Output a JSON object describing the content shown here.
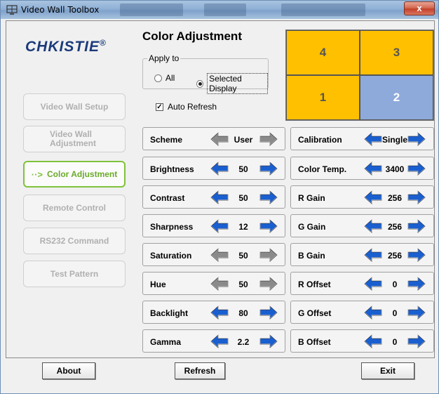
{
  "window": {
    "title": "Video Wall Toolbox",
    "close_label": "x"
  },
  "logo": {
    "text": "CHKISTIE",
    "reg": "®"
  },
  "sidebar": {
    "items": [
      {
        "label": "Video Wall Setup",
        "active": false
      },
      {
        "label": "Video Wall Adjustment",
        "active": false
      },
      {
        "label": "Color Adjustment",
        "active": true
      },
      {
        "label": "Remote Control",
        "active": false
      },
      {
        "label": "RS232 Command",
        "active": false
      },
      {
        "label": "Test Pattern",
        "active": false
      }
    ]
  },
  "header": {
    "title": "Color Adjustment",
    "apply_to": {
      "legend": "Apply to",
      "options": [
        "All",
        "Selected Display"
      ],
      "selected": "Selected Display"
    },
    "auto_refresh": {
      "label": "Auto Refresh",
      "checked": true
    }
  },
  "displays": [
    {
      "label": "4",
      "selected": false
    },
    {
      "label": "3",
      "selected": false
    },
    {
      "label": "1",
      "selected": false
    },
    {
      "label": "2",
      "selected": true
    }
  ],
  "left_controls": [
    {
      "label": "Scheme",
      "value": "User",
      "enabled": false
    },
    {
      "label": "Brightness",
      "value": "50",
      "enabled": true
    },
    {
      "label": "Contrast",
      "value": "50",
      "enabled": true
    },
    {
      "label": "Sharpness",
      "value": "12",
      "enabled": true
    },
    {
      "label": "Saturation",
      "value": "50",
      "enabled": false
    },
    {
      "label": "Hue",
      "value": "50",
      "enabled": false
    },
    {
      "label": "Backlight",
      "value": "80",
      "enabled": true
    },
    {
      "label": "Gamma",
      "value": "2.2",
      "enabled": true
    }
  ],
  "right_controls": [
    {
      "label": "Calibration",
      "value": "Single",
      "enabled": true
    },
    {
      "label": "Color Temp.",
      "value": "3400",
      "enabled": true
    },
    {
      "label": "R Gain",
      "value": "256",
      "enabled": true
    },
    {
      "label": "G Gain",
      "value": "256",
      "enabled": true
    },
    {
      "label": "B Gain",
      "value": "256",
      "enabled": true
    },
    {
      "label": "R Offset",
      "value": "0",
      "enabled": true
    },
    {
      "label": "G Offset",
      "value": "0",
      "enabled": true
    },
    {
      "label": "B Offset",
      "value": "0",
      "enabled": true
    }
  ],
  "footer": {
    "about": "About",
    "refresh": "Refresh",
    "exit": "Exit"
  },
  "colors": {
    "tile": "#ffc000",
    "tile_selected": "#8eaadb",
    "arrow_enabled": "#1a5fd0",
    "arrow_disabled": "#8a8a8a",
    "nav_active": "#7fc23a"
  }
}
